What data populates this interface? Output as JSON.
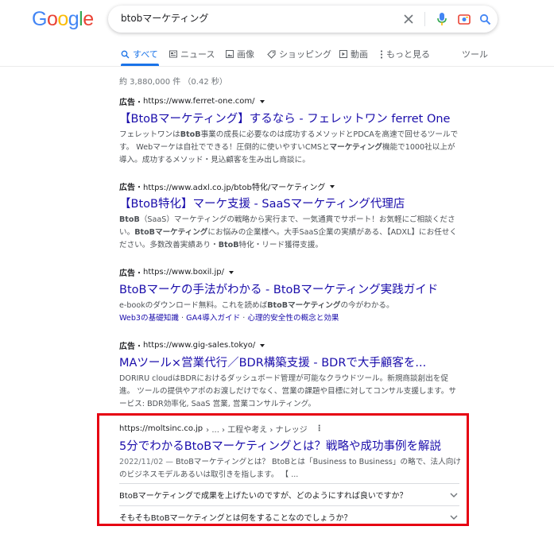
{
  "logo": {
    "letters": [
      "G",
      "o",
      "o",
      "g",
      "l",
      "e"
    ],
    "colors": [
      "#4285f4",
      "#ea4335",
      "#fbbc05",
      "#4285f4",
      "#34a853",
      "#ea4335"
    ]
  },
  "search": {
    "query": "btobマーケティング"
  },
  "tabs": [
    {
      "label": "すべて",
      "icon": "search-icon"
    },
    {
      "label": "ニュース",
      "icon": "news-icon"
    },
    {
      "label": "画像",
      "icon": "image-icon"
    },
    {
      "label": "ショッピング",
      "icon": "tag-icon"
    },
    {
      "label": "動画",
      "icon": "video-icon"
    },
    {
      "label": "もっと見る",
      "icon": "more-dots-icon"
    },
    {
      "label": "ツール"
    }
  ],
  "stats": "約 3,880,000 件 （0.42 秒）",
  "results": [
    {
      "ad": "広告",
      "url": "https://www.ferret-one.com/",
      "title": "【BtoBマーケティング】するなら - フェレットワン ferret One",
      "snippet": [
        "フェレットワンは",
        "BtoB",
        "事業の成長に必要なのは成功するメソッドとPDCAを高速で回せるツールです。 Webマーケは自社でできる！圧倒的に使いやすいCMSと",
        "マーケティング",
        "機能で1000社以上が導入。成功するメソッド・見込顧客を生み出し商談に。"
      ]
    },
    {
      "ad": "広告",
      "url": "https://www.adxl.co.jp/btob特化/マーケティング",
      "title": "【BtoB特化】マーケ支援 - SaaSマーケティング代理店",
      "snippet": [
        "BtoB",
        "（SaaS）マーケティングの戦略から実行まで、一気通貫でサポート！お気軽にご相談ください。",
        "BtoBマーケティング",
        "にお悩みの企業様へ。大手SaaS企業の実績がある、【ADXL】にお任せください。多数改善実績あり・",
        "BtoB",
        "特化・リード獲得支援。"
      ]
    },
    {
      "ad": "広告",
      "url": "https://www.boxil.jp/",
      "title": "BtoBマーケの手法がわかる - BtoBマーケティング実践ガイド",
      "snippet": [
        "e-bookのダウンロード無料。これを読めば",
        "BtoBマーケティング",
        "の今がわかる。"
      ],
      "sitelinks": [
        "Web3の基礎知識",
        "GA4導入ガイド",
        "心理的安全性の概念と効果"
      ]
    },
    {
      "ad": "広告",
      "url": "https://www.gig-sales.tokyo/",
      "title": "MAツール×営業代行／BDR構築支援 - BDRで大手顧客を...",
      "snippet": [
        "DORIRU cloudはBDRにおけるダッシュボード管理が可能なクラウドツール。新規商談創出を促進。 ツールの提供やアポのお渡しだけでなく、営業の課題や目標に対してコンサル支援します。サービス: BDR効率化, SaaS 営業, 営業コンサルティング。"
      ]
    }
  ],
  "organic": {
    "cite_domain": "https://moltsinc.co.jp",
    "cite_path": "› ... › 工程や考え › ナレッジ",
    "title": "5分でわかるBtoBマーケティングとは？戦略や成功事例を解説",
    "date": "2022/11/02 — ",
    "snippet": "BtoBマーケティングとは？ BtoBとは「Business to Business」の略で、法人向けのビジネスモデルあるいは取引きを指します。 【 ...",
    "faqs": [
      "BtoBマーケティングで成果を上げたいのですが、どのようにすれば良いですか？",
      "そもそもBtoBマーケティングとは何をすることなのでしょうか？"
    ]
  },
  "highlight_color": "#e60012"
}
